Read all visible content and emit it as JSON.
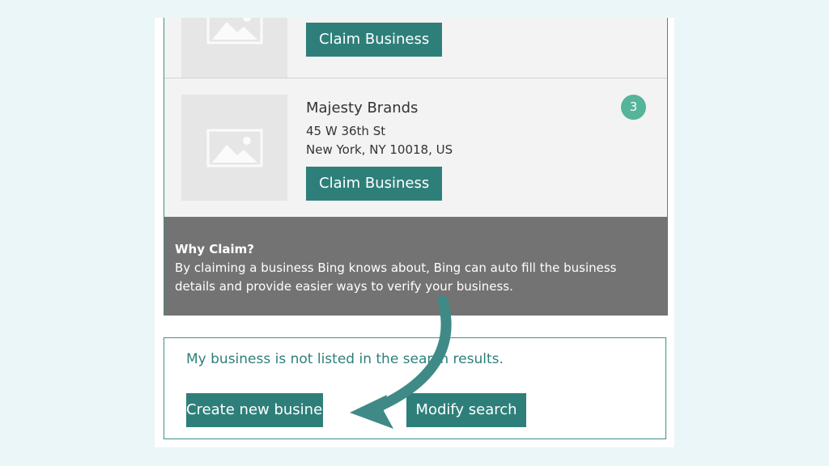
{
  "results": [
    {
      "name": "",
      "address_line1": "",
      "address_line2": "",
      "claim_label": "Claim Business"
    },
    {
      "rank": "3",
      "name": "Majesty Brands",
      "address_line1": "45 W 36th St",
      "address_line2": "New York, NY 10018, US",
      "claim_label": "Claim Business"
    }
  ],
  "why_claim": {
    "title": "Why Claim?",
    "text": "By claiming a business Bing knows about, Bing can auto fill the business details and provide easier ways to verify your business."
  },
  "not_listed": {
    "text": "My business is not listed in the search results.",
    "create_label": "Create new business",
    "modify_label": "Modify search"
  },
  "colors": {
    "accent": "#2e7f7a",
    "rank_badge": "#55b49a",
    "why_bg": "#737373",
    "background": "#eaf6f8",
    "arrow": "#3f8a86"
  },
  "icons": {
    "thumbnail": "image-placeholder-icon",
    "annotation": "curved-arrow-icon"
  }
}
